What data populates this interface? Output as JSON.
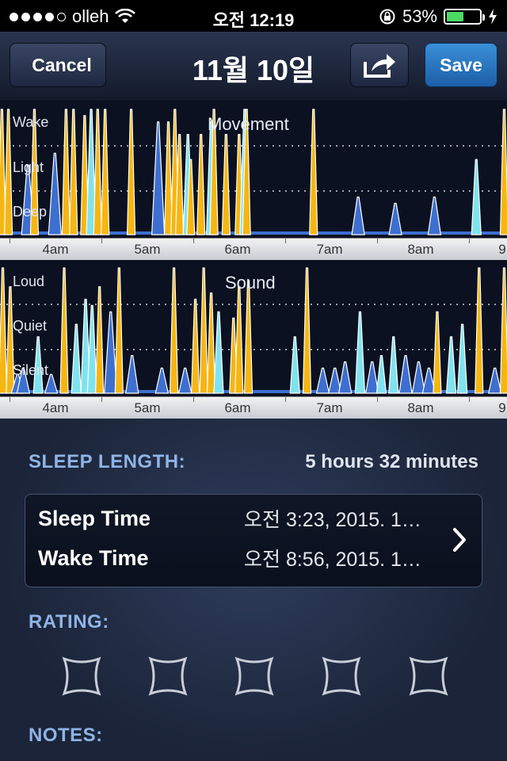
{
  "status_bar": {
    "carrier": "olleh",
    "time": "오전 12:19",
    "battery_percent": "53%",
    "battery_level": 0.53,
    "signal_dots_filled": 4,
    "signal_dots_total": 5,
    "icons": [
      "wifi-icon",
      "rotation-lock-icon",
      "battery-icon",
      "charging-icon"
    ]
  },
  "nav": {
    "cancel_label": "Cancel",
    "title": "11월 10일",
    "share_icon": "share-icon",
    "save_label": "Save"
  },
  "movement_chart": {
    "title": "Movement",
    "levels": [
      "Wake",
      "Light",
      "Deep"
    ],
    "x_ticks": [
      "4am",
      "5am",
      "6am",
      "7am",
      "8am",
      "9"
    ]
  },
  "sound_chart": {
    "title": "Sound",
    "levels": [
      "Loud",
      "Quiet",
      "Silent"
    ],
    "x_ticks": [
      "4am",
      "5am",
      "6am",
      "7am",
      "8am",
      "9"
    ]
  },
  "chart_data": [
    {
      "type": "area",
      "title": "Movement",
      "x_unit": "hours",
      "xlim": [
        3.55,
        9.0
      ],
      "y_levels": [
        "Deep",
        "Light",
        "Wake"
      ],
      "ylim": [
        0,
        1
      ],
      "spikes": [
        {
          "x": 3.57,
          "y": 1.0,
          "color": "yellow"
        },
        {
          "x": 3.64,
          "y": 1.0,
          "color": "yellow"
        },
        {
          "x": 3.85,
          "y": 0.55,
          "color": "blue"
        },
        {
          "x": 3.92,
          "y": 1.0,
          "color": "yellow"
        },
        {
          "x": 4.14,
          "y": 0.65,
          "color": "blue"
        },
        {
          "x": 4.26,
          "y": 1.0,
          "color": "yellow"
        },
        {
          "x": 4.34,
          "y": 1.0,
          "color": "yellow"
        },
        {
          "x": 4.46,
          "y": 0.95,
          "color": "yellow"
        },
        {
          "x": 4.53,
          "y": 1.0,
          "color": "cyan"
        },
        {
          "x": 4.6,
          "y": 1.0,
          "color": "yellow"
        },
        {
          "x": 4.68,
          "y": 1.0,
          "color": "yellow"
        },
        {
          "x": 4.96,
          "y": 1.0,
          "color": "yellow"
        },
        {
          "x": 5.25,
          "y": 0.9,
          "color": "blue"
        },
        {
          "x": 5.36,
          "y": 0.9,
          "color": "yellow"
        },
        {
          "x": 5.43,
          "y": 1.0,
          "color": "yellow"
        },
        {
          "x": 5.48,
          "y": 0.8,
          "color": "yellow"
        },
        {
          "x": 5.57,
          "y": 0.8,
          "color": "cyan"
        },
        {
          "x": 5.6,
          "y": 0.6,
          "color": "yellow"
        },
        {
          "x": 5.71,
          "y": 0.8,
          "color": "yellow"
        },
        {
          "x": 5.82,
          "y": 0.9,
          "color": "cyan"
        },
        {
          "x": 5.85,
          "y": 1.0,
          "color": "yellow"
        },
        {
          "x": 5.98,
          "y": 0.8,
          "color": "yellow"
        },
        {
          "x": 6.12,
          "y": 0.8,
          "color": "yellow"
        },
        {
          "x": 6.18,
          "y": 1.0,
          "color": "cyan"
        },
        {
          "x": 6.2,
          "y": 1.0,
          "color": "yellow"
        },
        {
          "x": 6.92,
          "y": 1.0,
          "color": "yellow"
        },
        {
          "x": 7.4,
          "y": 0.3,
          "color": "blue"
        },
        {
          "x": 7.8,
          "y": 0.25,
          "color": "blue"
        },
        {
          "x": 8.22,
          "y": 0.3,
          "color": "blue"
        },
        {
          "x": 8.67,
          "y": 0.6,
          "color": "cyan"
        },
        {
          "x": 8.97,
          "y": 1.0,
          "color": "yellow"
        }
      ]
    },
    {
      "type": "area",
      "title": "Sound",
      "x_unit": "hours",
      "xlim": [
        3.55,
        9.0
      ],
      "y_levels": [
        "Silent",
        "Quiet",
        "Loud"
      ],
      "ylim": [
        0,
        1
      ],
      "spikes": [
        {
          "x": 3.58,
          "y": 1.0,
          "color": "yellow"
        },
        {
          "x": 3.66,
          "y": 0.85,
          "color": "yellow"
        },
        {
          "x": 3.74,
          "y": 0.15,
          "color": "blue"
        },
        {
          "x": 3.8,
          "y": 0.2,
          "color": "blue"
        },
        {
          "x": 3.96,
          "y": 0.45,
          "color": "cyan"
        },
        {
          "x": 4.1,
          "y": 0.15,
          "color": "blue"
        },
        {
          "x": 4.24,
          "y": 1.0,
          "color": "yellow"
        },
        {
          "x": 4.37,
          "y": 0.55,
          "color": "cyan"
        },
        {
          "x": 4.47,
          "y": 0.75,
          "color": "cyan"
        },
        {
          "x": 4.54,
          "y": 0.7,
          "color": "cyan"
        },
        {
          "x": 4.62,
          "y": 0.85,
          "color": "yellow"
        },
        {
          "x": 4.74,
          "y": 0.65,
          "color": "blue"
        },
        {
          "x": 4.83,
          "y": 1.0,
          "color": "yellow"
        },
        {
          "x": 4.97,
          "y": 0.3,
          "color": "blue"
        },
        {
          "x": 5.29,
          "y": 0.2,
          "color": "blue"
        },
        {
          "x": 5.42,
          "y": 1.0,
          "color": "yellow"
        },
        {
          "x": 5.54,
          "y": 0.2,
          "color": "blue"
        },
        {
          "x": 5.65,
          "y": 0.75,
          "color": "yellow"
        },
        {
          "x": 5.74,
          "y": 1.0,
          "color": "yellow"
        },
        {
          "x": 5.82,
          "y": 0.8,
          "color": "yellow"
        },
        {
          "x": 5.9,
          "y": 0.65,
          "color": "cyan"
        },
        {
          "x": 6.06,
          "y": 0.6,
          "color": "yellow"
        },
        {
          "x": 6.12,
          "y": 0.85,
          "color": "yellow"
        },
        {
          "x": 6.22,
          "y": 0.9,
          "color": "yellow"
        },
        {
          "x": 6.72,
          "y": 0.45,
          "color": "cyan"
        },
        {
          "x": 6.85,
          "y": 1.0,
          "color": "yellow"
        },
        {
          "x": 7.02,
          "y": 0.2,
          "color": "blue"
        },
        {
          "x": 7.15,
          "y": 0.2,
          "color": "blue"
        },
        {
          "x": 7.26,
          "y": 0.25,
          "color": "blue"
        },
        {
          "x": 7.42,
          "y": 0.65,
          "color": "cyan"
        },
        {
          "x": 7.55,
          "y": 0.25,
          "color": "blue"
        },
        {
          "x": 7.65,
          "y": 0.3,
          "color": "cyan"
        },
        {
          "x": 7.78,
          "y": 0.45,
          "color": "cyan"
        },
        {
          "x": 7.91,
          "y": 0.3,
          "color": "blue"
        },
        {
          "x": 8.05,
          "y": 0.25,
          "color": "blue"
        },
        {
          "x": 8.16,
          "y": 0.2,
          "color": "blue"
        },
        {
          "x": 8.25,
          "y": 0.65,
          "color": "yellow"
        },
        {
          "x": 8.4,
          "y": 0.45,
          "color": "cyan"
        },
        {
          "x": 8.52,
          "y": 0.55,
          "color": "cyan"
        },
        {
          "x": 8.7,
          "y": 1.0,
          "color": "yellow"
        },
        {
          "x": 8.87,
          "y": 0.2,
          "color": "blue"
        },
        {
          "x": 8.97,
          "y": 1.0,
          "color": "yellow"
        }
      ]
    }
  ],
  "summary": {
    "sleep_length_label": "SLEEP LENGTH:",
    "sleep_length_value": "5 hours 32 minutes",
    "sleep_time_label": "Sleep Time",
    "sleep_time_value": "오전 3:23, 2015. 1…",
    "wake_time_label": "Wake Time",
    "wake_time_value": "오전 8:56, 2015. 1…",
    "rating_label": "RATING:",
    "rating_value": 0,
    "rating_max": 5,
    "notes_label": "NOTES:"
  },
  "colors": {
    "yellow": "#f6b612",
    "cyan": "#7fe3ef",
    "blue": "#3d6fd0",
    "chart_bg": "#0b1120",
    "accent_label": "#8fb4e6",
    "save_button": "#2a7cc9"
  }
}
